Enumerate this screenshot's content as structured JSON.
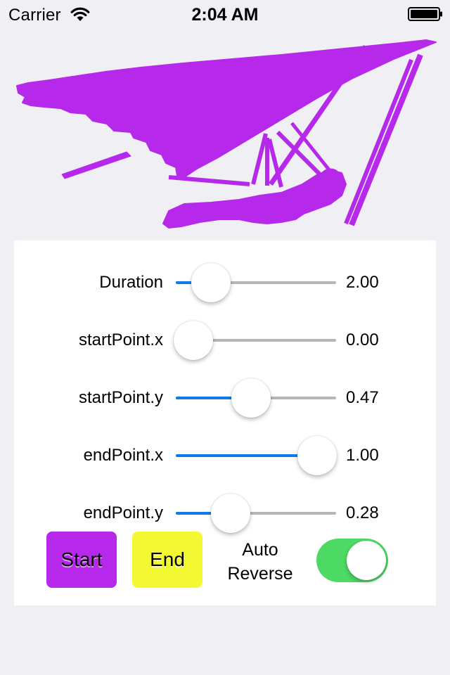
{
  "status_bar": {
    "carrier": "Carrier",
    "time": "2:04 AM",
    "wifi_icon": "wifi-icon",
    "battery_icon": "battery-icon"
  },
  "glider": {
    "color": "#b629ea",
    "icon": "hang-glider-image"
  },
  "sliders": [
    {
      "label": "Duration",
      "value_text": "2.00",
      "fraction": 0.22
    },
    {
      "label": "startPoint.x",
      "value_text": "0.00",
      "fraction": 0.11
    },
    {
      "label": "startPoint.y",
      "value_text": "0.47",
      "fraction": 0.47
    },
    {
      "label": "endPoint.x",
      "value_text": "1.00",
      "fraction": 0.88
    },
    {
      "label": "endPoint.y",
      "value_text": "0.28",
      "fraction": 0.34
    }
  ],
  "buttons": {
    "start": {
      "label": "Start",
      "color": "#b629ea"
    },
    "end": {
      "label": "End",
      "color": "#f2f933"
    }
  },
  "auto_reverse": {
    "label_line1": "Auto",
    "label_line2": "Reverse",
    "on": true,
    "on_color": "#4cd964"
  },
  "colors": {
    "accent": "#0e7ce8",
    "background": "#efeff4",
    "track": "#b6b6b6"
  }
}
